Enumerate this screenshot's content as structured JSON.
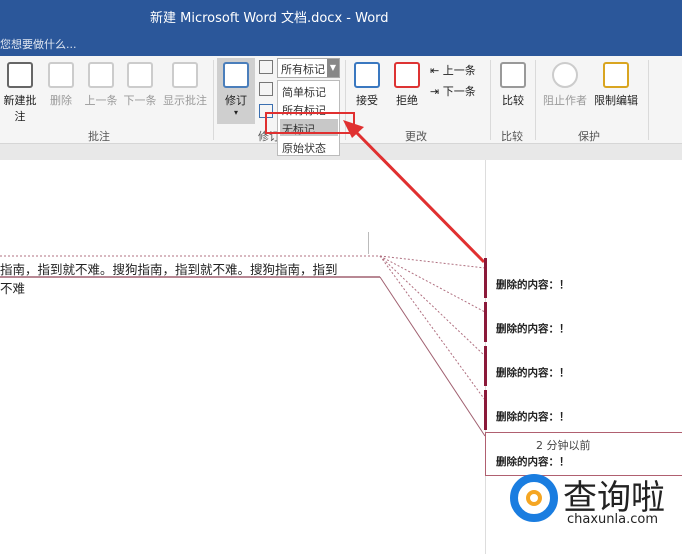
{
  "window": {
    "title": "新建 Microsoft Word 文档.docx - Word",
    "tell_me": "您想要做什么..."
  },
  "ribbon": {
    "comments_group": {
      "label": "批注",
      "buttons": [
        "新建批注",
        "删除",
        "上一条",
        "下一条",
        "显示批注"
      ]
    },
    "tracking_group": {
      "label": "修订",
      "track_button": "修订",
      "markup_combo": "所有标记",
      "dropdown": [
        "简单标记",
        "所有标记",
        "无标记",
        "原始状态"
      ],
      "highlighted": "无标记"
    },
    "changes_group": {
      "label": "更改",
      "accept": "接受",
      "reject": "拒绝",
      "previous": "上一条",
      "next": "下一条"
    },
    "compare_group": {
      "label": "比较",
      "compare": "比较"
    },
    "protect_group": {
      "label": "保护",
      "block_authors": "阻止作者",
      "restrict_editing": "限制编辑"
    }
  },
  "document": {
    "line1": "指南，指到就不难。搜狗指南，指到就不难。搜狗指南，指到",
    "line2": "不难"
  },
  "markup": {
    "comments": [
      "删除的内容：！",
      "删除的内容：！",
      "删除的内容：！",
      "删除的内容：！",
      "删除的内容：！"
    ],
    "time": "2 分钟以前"
  },
  "watermark": {
    "text": "查询啦",
    "domain": "chaxunla.com"
  },
  "colors": {
    "title_bar": "#2b579a",
    "highlight_box": "#e03030",
    "revision": "#8b1a3a"
  }
}
